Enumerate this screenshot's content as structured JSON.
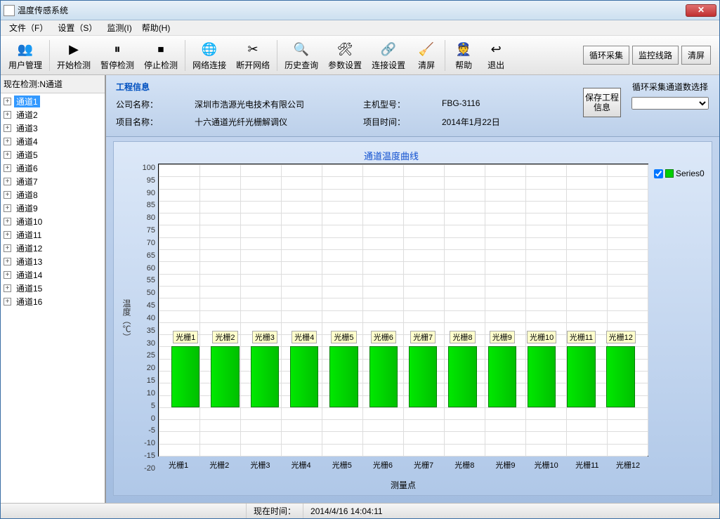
{
  "window": {
    "title": "温度传感系统"
  },
  "menubar": [
    "文件（F）",
    "设置（S）",
    "监测(I)",
    "帮助(H)"
  ],
  "toolbar": [
    {
      "label": "用户管理",
      "icon": "👥"
    },
    {
      "label": "开始检测",
      "icon": "▶"
    },
    {
      "label": "暂停检测",
      "icon": "⏸"
    },
    {
      "label": "停止检测",
      "icon": "⏹"
    },
    {
      "label": "网络连接",
      "icon": "🌐"
    },
    {
      "label": "断开网络",
      "icon": "✂"
    },
    {
      "label": "历史查询",
      "icon": "🔍"
    },
    {
      "label": "参数设置",
      "icon": "🛠"
    },
    {
      "label": "连接设置",
      "icon": "🔗"
    },
    {
      "label": "清屏",
      "icon": "🧹"
    },
    {
      "label": "帮助",
      "icon": "👮"
    },
    {
      "label": "退出",
      "icon": "↩"
    }
  ],
  "rightButtons": [
    "循环采集",
    "监控线路",
    "清屏"
  ],
  "sidebar": {
    "title": "现在检测:N通道",
    "items": [
      "通道1",
      "通道2",
      "通道3",
      "通道4",
      "通道5",
      "通道6",
      "通道7",
      "通道8",
      "通道9",
      "通道10",
      "通道11",
      "通道12",
      "通道13",
      "通道14",
      "通道15",
      "通道16"
    ],
    "selectedIndex": 0
  },
  "info": {
    "panelTitle": "工程信息",
    "companyLabel": "公司名称：",
    "company": "深圳市浩源光电技术有限公司",
    "modelLabel": "主机型号：",
    "model": "FBG-3116",
    "projectLabel": "项目名称：",
    "project": "十六通道光纤光栅解调仪",
    "timeLabel": "项目时间：",
    "time": "2014年1月22日",
    "saveBtn": "保存工程信息",
    "cornerTitle": "循环采集通道数选择"
  },
  "chart_data": {
    "type": "bar",
    "title": "通道温度曲线",
    "ylabel": "温度（℃）",
    "xlabel": "测量点",
    "ylim": [
      -20,
      100
    ],
    "yticks": [
      100,
      95,
      90,
      85,
      80,
      75,
      70,
      65,
      60,
      55,
      50,
      45,
      40,
      35,
      30,
      25,
      20,
      15,
      10,
      5,
      0,
      -5,
      -10,
      -15,
      -20
    ],
    "categories": [
      "光栅1",
      "光栅2",
      "光栅3",
      "光栅4",
      "光栅5",
      "光栅6",
      "光栅7",
      "光栅8",
      "光栅9",
      "光栅10",
      "光栅11",
      "光栅12"
    ],
    "barLabels": [
      "光栅1",
      "光栅2",
      "光栅3",
      "光栅4",
      "光栅5",
      "光栅6",
      "光栅7",
      "光栅8",
      "光栅9",
      "光栅10",
      "光栅11",
      "光栅12"
    ],
    "values": [
      25,
      25,
      25,
      25,
      25,
      25,
      25,
      25,
      25,
      25,
      25,
      25
    ],
    "series": [
      {
        "name": "Series0",
        "color": "#00d000"
      }
    ]
  },
  "status": {
    "timeLabel": "现在时间：",
    "time": "2014/4/16 14:04:11"
  }
}
